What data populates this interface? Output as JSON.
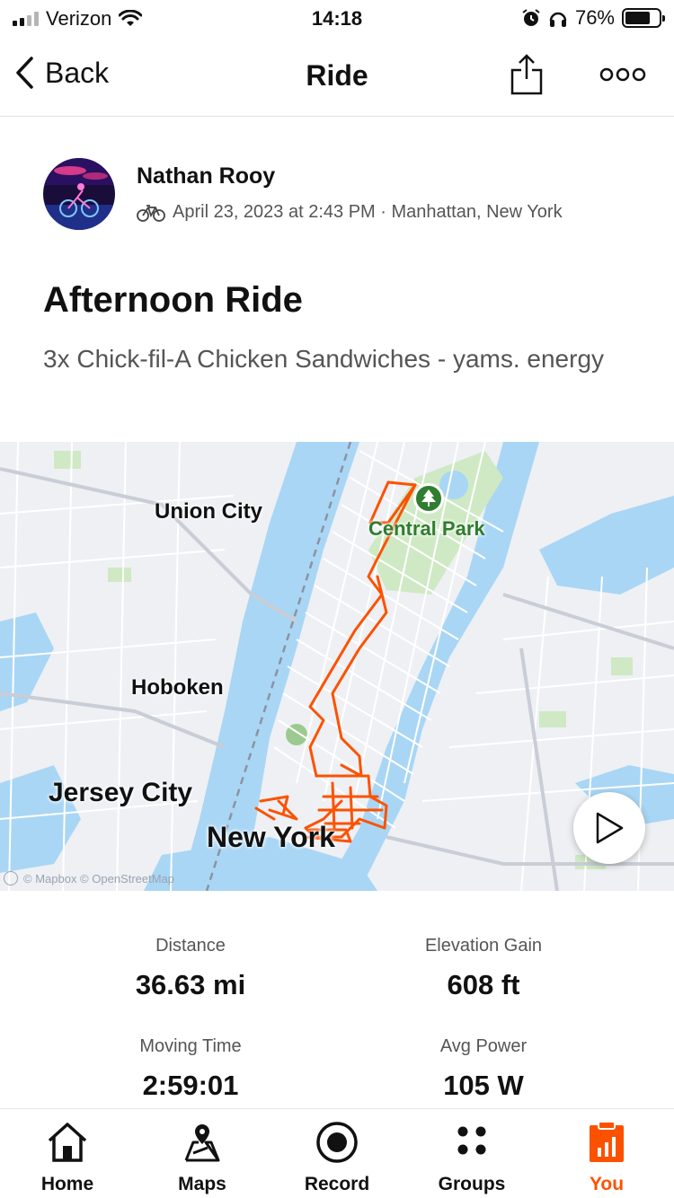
{
  "status_bar": {
    "carrier": "Verizon",
    "time": "14:18",
    "battery": "76%",
    "battery_level": 0.76
  },
  "nav": {
    "back_label": "Back",
    "title": "Ride",
    "share_icon": "share-icon",
    "more_icon": "more-icon"
  },
  "activity": {
    "athlete_name": "Nathan Rooy",
    "sport_icon": "bike-icon",
    "meta": "April 23, 2023 at 2:43 PM · Manhattan, New York",
    "title": "Afternoon Ride",
    "description": "3x Chick-fil-A Chicken Sandwiches - yams. energy"
  },
  "map": {
    "labels": {
      "union_city": "Union City",
      "hoboken": "Hoboken",
      "jersey_city": "Jersey City",
      "new_york": "New York",
      "central_park": "Central Park"
    },
    "attribution": "© Mapbox © OpenStreetMap",
    "route_color": "#fc5200",
    "water_color": "#a9d6f5",
    "park_color": "#cfe9c4"
  },
  "stats": [
    {
      "label": "Distance",
      "value": "36.63 mi"
    },
    {
      "label": "Elevation Gain",
      "value": "608 ft"
    },
    {
      "label": "Moving Time",
      "value": "2:59:01"
    },
    {
      "label": "Avg Power",
      "value": "105 W"
    }
  ],
  "tabbar": {
    "accent": "#fc5200",
    "tabs": [
      {
        "label": "Home",
        "icon": "home-icon"
      },
      {
        "label": "Maps",
        "icon": "maps-icon"
      },
      {
        "label": "Record",
        "icon": "record-icon"
      },
      {
        "label": "Groups",
        "icon": "groups-icon"
      },
      {
        "label": "You",
        "icon": "you-icon",
        "active": true
      }
    ]
  }
}
